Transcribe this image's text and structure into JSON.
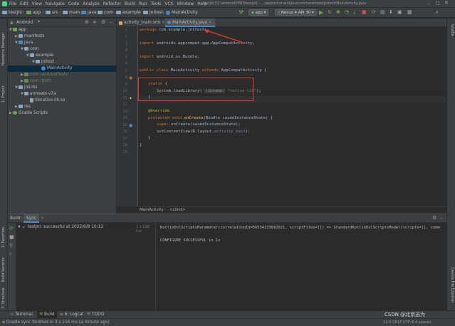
{
  "menu": {
    "items": [
      "File",
      "Edit",
      "View",
      "Navigate",
      "Code",
      "Analyze",
      "Refactor",
      "Build",
      "Run",
      "Tools",
      "VCS",
      "Window",
      "Help"
    ],
    "window_title": "testjni [G:\\android\\PRO\\testjni] - ...\\app\\src\\main\\java\\com\\example\\jnitest\\MainActivity.java"
  },
  "breadcrumbs": [
    "testjni",
    "app",
    "src",
    "main",
    "java",
    "com",
    "example",
    "jnitest",
    "MainActivity"
  ],
  "toolbar": {
    "module": "app",
    "device": "Nexus 4 API 30"
  },
  "left_strip": {
    "resource_manager": "Resource Manager",
    "project": "1: Project",
    "favorites": "2: Favorites",
    "build_variants": "Build Variants",
    "structure": "7: Structure"
  },
  "right_strip": {
    "gradle": "Gradle",
    "device_explorer": "Device File Explorer"
  },
  "project_panel": {
    "view_selector": "Android",
    "tree": [
      {
        "label": "app",
        "level": 0,
        "kind": "module",
        "expanded": true
      },
      {
        "label": "manifests",
        "level": 1,
        "kind": "folder",
        "expanded": false
      },
      {
        "label": "java",
        "level": 1,
        "kind": "folder",
        "expanded": true
      },
      {
        "label": "com",
        "level": 2,
        "kind": "package",
        "expanded": true
      },
      {
        "label": "example",
        "level": 3,
        "kind": "package",
        "expanded": true
      },
      {
        "label": "jnitest",
        "level": 4,
        "kind": "package",
        "expanded": true
      },
      {
        "label": "MainActivity",
        "level": 5,
        "kind": "class",
        "selected": true
      },
      {
        "label": "com (androidTest)",
        "level": 2,
        "kind": "package-test",
        "expanded": false
      },
      {
        "label": "com (test)",
        "level": 2,
        "kind": "package-test",
        "expanded": false
      },
      {
        "label": "jniLibs",
        "level": 1,
        "kind": "folder",
        "expanded": true
      },
      {
        "label": "armeabi-v7a",
        "level": 2,
        "kind": "folder",
        "expanded": true
      },
      {
        "label": "libnative-lib.so",
        "level": 3,
        "kind": "file"
      },
      {
        "label": "res",
        "level": 1,
        "kind": "folder",
        "expanded": false
      },
      {
        "label": "Gradle Scripts",
        "level": 0,
        "kind": "gradle",
        "expanded": false
      }
    ]
  },
  "editor": {
    "tabs": [
      {
        "label": "activity_main.xml",
        "active": false
      },
      {
        "label": "MainActivity.java",
        "active": true
      }
    ],
    "line_numbers": [
      "1",
      "2",
      "3",
      "4",
      "5",
      "6",
      "7",
      "8",
      "9",
      "10",
      "11",
      "12",
      "13",
      "14",
      "15",
      "16",
      "17",
      "18",
      "19"
    ],
    "code": {
      "l1_kw": "package",
      "l1_rest": " com.example.jnitest;",
      "l3_kw": "import",
      "l3_rest": " androidx.appcompat.app.AppCompatActivity;",
      "l5_kw": "import",
      "l5_rest": " android.os.Bundle;",
      "l7_kw": "public class",
      "l7_rest": " MainActivity ",
      "l7_kw2": "extends",
      "l7_rest2": " AppCompatActivity {",
      "l9_kw": "static",
      "l9_rest": " {",
      "l10_a": "System.",
      "l10_fn": "loadLibrary",
      "l10_b": "( ",
      "l10_hint": "libname:",
      "l10_str": " \"native-lib\"",
      "l10_c": ");",
      "l11": "}",
      "l13_ann": "@Override",
      "l14_kw": "protected void",
      "l14_fn": " onCreate",
      "l14_rest": "(Bundle savedInstanceState) {",
      "l15_kw": "super",
      "l15_rest": ".onCreate(savedInstanceState);",
      "l16_a": "setContentView(R.layout.",
      "l16_ital": "activity_main",
      "l16_b": ");",
      "l17": "}",
      "l18": "}"
    },
    "breadcrumb": [
      "MainActivity",
      "<clinit>"
    ]
  },
  "build_panel": {
    "title": "Build:",
    "tab": "Sync",
    "status_text": "testjni: successful at 2022/6/8 10:12",
    "duration": "1 s 116 ms",
    "console": [
      "KotlinDslScriptsParameter(correlationId=56534133892021, scriptFiles=[]) => StandardKotlinDslScriptsModel(scripts=[], comm",
      "",
      "CONFIGURE SUCCESSFUL in 1s"
    ]
  },
  "bottom_tabs": [
    "Terminal",
    "Build",
    "6: Logcat",
    "TODO"
  ],
  "status": {
    "message": "Gradle sync finished in 3 s 116 ms (a minute ago)",
    "position": "11:6  CRLF  UTF-8  4 spaces",
    "watermark": "CSDN @北京迅为"
  },
  "colors": {
    "accent": "#4a88c7",
    "highlight": "#e53935",
    "keyword": "#cc7832",
    "string": "#6a8759"
  }
}
